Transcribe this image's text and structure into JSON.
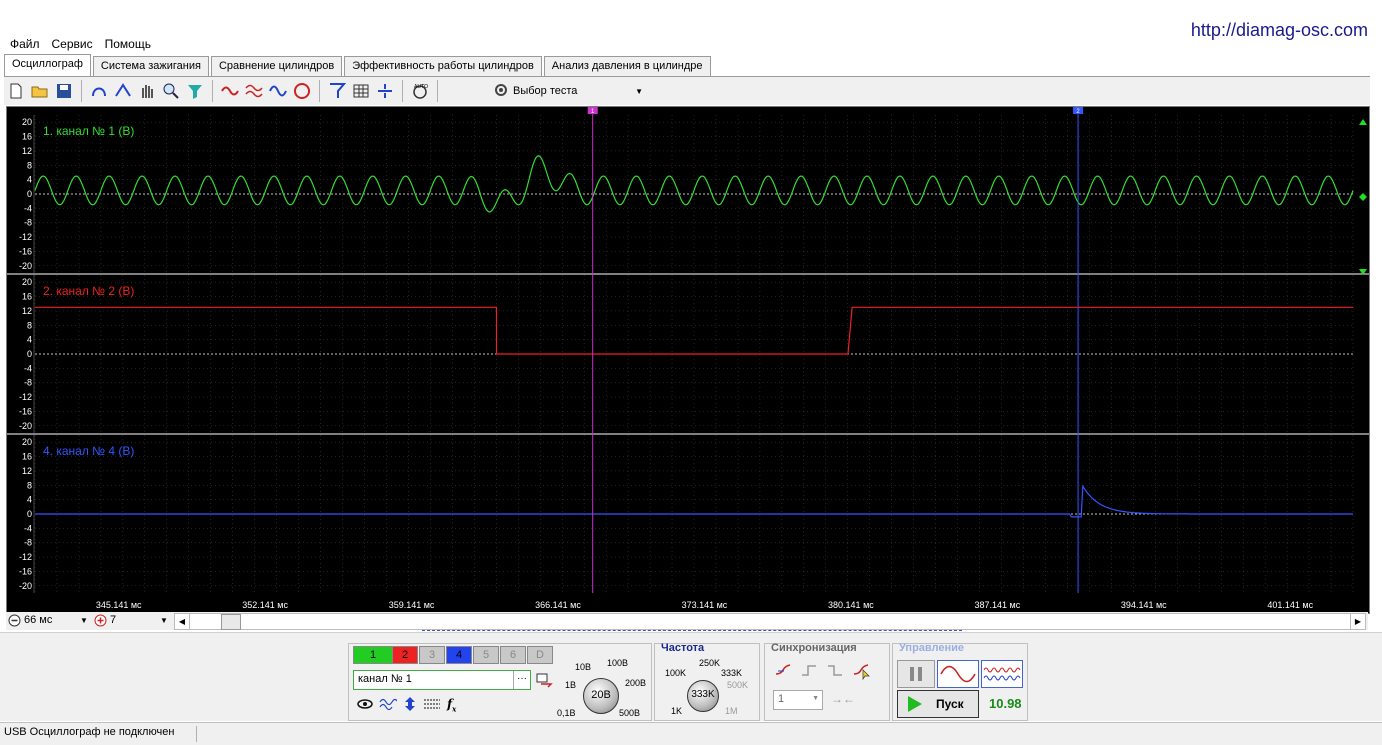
{
  "site_url": "http://diamag-osc.com",
  "menu": [
    "Файл",
    "Сервис",
    "Помощь"
  ],
  "tabs": [
    {
      "label": "Осциллограф",
      "active": true
    },
    {
      "label": "Система зажигания",
      "active": false
    },
    {
      "label": "Сравнение цилиндров",
      "active": false
    },
    {
      "label": "Эффективность работы цилиндров",
      "active": false
    },
    {
      "label": "Анализ давления в цилиндре",
      "active": false
    }
  ],
  "toolbar": {
    "icons": [
      "new-file-icon",
      "open-folder-icon",
      "save-icon",
      "probe-icon",
      "cursor-measure-icon",
      "hand-pan-icon",
      "zoom-icon",
      "filter-icon",
      "invert-icon",
      "overlay-icon",
      "channel-view-icon",
      "auto-scale-icon",
      "trigger-icon",
      "grid-icon",
      "split-icon",
      "auto-detect-icon"
    ],
    "test_select_label": "Выбор теста"
  },
  "scope": {
    "cursor_labels": [
      "1",
      "2"
    ],
    "y_ticks": [
      "20",
      "16",
      "12",
      "8",
      "4",
      "0",
      "-4",
      "-8",
      "-12",
      "-16",
      "-20"
    ],
    "x_ticks": [
      "345.141 мс",
      "352.141 мс",
      "359.141 мс",
      "366.141 мс",
      "373.141 мс",
      "380.141 мс",
      "387.141 мс",
      "394.141 мс",
      "401.141 мс"
    ],
    "channels": [
      {
        "label": "1. канал № 1 (В)",
        "color": "#33dd33"
      },
      {
        "label": "2. канал № 2 (В)",
        "color": "#ee2222"
      },
      {
        "label": "4. канал № 4 (В)",
        "color": "#3355ff"
      }
    ]
  },
  "chart_data": {
    "type": "line",
    "x_unit": "мс",
    "xlim": [
      341.141,
      404.141
    ],
    "ylim": [
      -22,
      22
    ],
    "y_unit": "В",
    "series": [
      {
        "name": "канал № 1",
        "signal": "sine",
        "amplitude_v": 4,
        "offset_v": 1,
        "cycles_in_view": 40,
        "disturbance_at_ms": 365.0
      },
      {
        "name": "канал № 2",
        "signal": "step",
        "high_v": 13,
        "low_v": 0,
        "low_from_ms": 363.2,
        "low_to_ms": 380.0
      },
      {
        "name": "канал № 4",
        "signal": "pulse",
        "base_v": 0,
        "peak_v": 8,
        "peak_at_ms": 391.2
      }
    ],
    "cursors_ms": [
      367.8,
      391.0
    ]
  },
  "zoom": {
    "time_value": "66 мс",
    "channel_value": "7"
  },
  "channel_panel": {
    "buttons": [
      "1",
      "2",
      "3",
      "4",
      "5",
      "6",
      "D"
    ],
    "button_colors": [
      "#22cc22",
      "#ee2222",
      "#c8c8c8",
      "#2244ee",
      "#c8c8c8",
      "#c8c8c8",
      "#c8c8c8"
    ],
    "name_value": "канал № 1",
    "voltage_labels": [
      "10В",
      "100В",
      "1В",
      "200В",
      "0,1В",
      "500В"
    ],
    "voltage_value": "20В"
  },
  "frequency": {
    "title": "Частота",
    "labels": [
      "250K",
      "100K",
      "333K",
      "500K",
      "1K",
      "1M"
    ],
    "value": "333K"
  },
  "sync": {
    "title": "Синхронизация",
    "channel_value": "1"
  },
  "control": {
    "title": "Управление",
    "start_label": "Пуск",
    "value": "10.98"
  },
  "status_text": "USB Осциллограф не подключен"
}
